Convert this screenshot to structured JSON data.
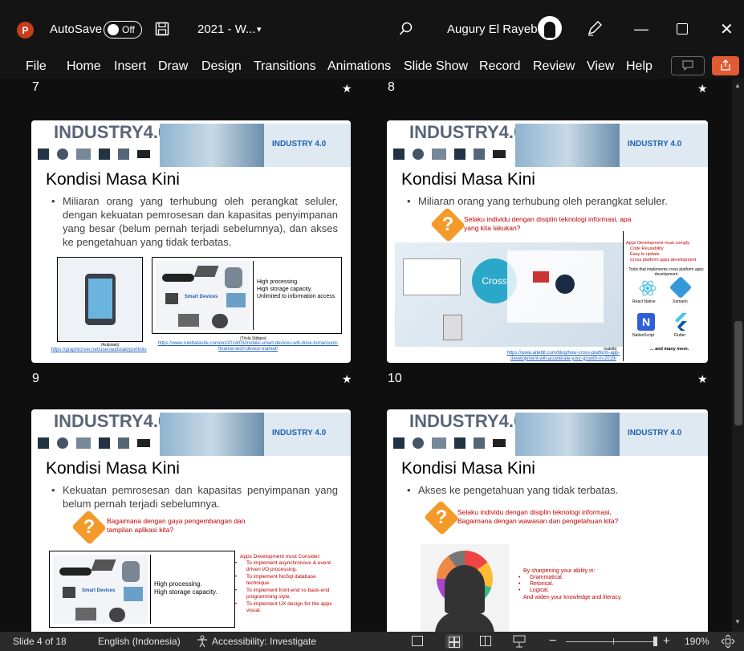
{
  "titlebar": {
    "app_badge": "P",
    "autosave_label": "AutoSave",
    "autosave_state": "Off",
    "doc_title": "2021 - W...",
    "user_name": "Augury El Rayeb"
  },
  "menu": [
    "File",
    "Home",
    "Insert",
    "Draw",
    "Design",
    "Transitions",
    "Animations",
    "Slide Show",
    "Record",
    "Review",
    "View",
    "Help"
  ],
  "slides": [
    {
      "number": "7",
      "banner_title": "INDUSTRY4.0",
      "banner_sub": "INDUSTRY 4.0",
      "heading": "Kondisi Masa Kini",
      "bullet": "Miliaran orang yang terhubung oleh perangkat seluler, dengan kekuatan pemrosesan dan kapasitas penyimpanan yang besar (belum pernah terjadi sebelumnya), dan akses ke pengetahuan yang tidak terbatas.",
      "box_text": "High processing.\nHigh storage capacity.\nUnlimited to information access",
      "smart_devices": "Smart Devices",
      "credit1": "(Autistaki)",
      "link1": "https://graphicriver.net/user/autistaki/portfolio",
      "credit2": "(Trisla Sittiges)",
      "link2": "https://www.rulebatasite.com/en/2014/03/mobile-smart-devices-will-drive-turnaround-finance-tech-device-market/"
    },
    {
      "number": "8",
      "banner_title": "INDUSTRY4.0",
      "banner_sub": "INDUSTRY 4.0",
      "heading": "Kondisi Masa Kini",
      "bullet": "Miliaran orang yang terhubung oleh perangkat seluler.",
      "question": "Selaku individu dengan disiplin teknologi informasi, apa yang kita lakukan?",
      "apps_title": "Apps Development must comply:",
      "apps_items": [
        "Code Reusability",
        "Easy to update",
        "Cross platform apps development"
      ],
      "tools_text": "Tools that implements cross platform apps development",
      "tool_names": [
        "React Native",
        "Xamarin",
        "NativeScript",
        "Flutter"
      ],
      "many_more": "... and many more.",
      "cross_label": "Cross",
      "credit": "(saktib)",
      "link": "https://www.aiteblt.com/blog/how-cross-platform-app-development-will-accelerate-your-growth-in-2019/"
    },
    {
      "number": "9",
      "banner_title": "INDUSTRY4.0",
      "banner_sub": "INDUSTRY 4.0",
      "heading": "Kondisi Masa Kini",
      "bullet": "Kekuatan pemrosesan dan kapasitas penyimpanan yang belum pernah terjadi sebelumnya.",
      "question": "Bagaimana dengan gaya pengembangan dan tampilan aplikasi kita?",
      "box_text": "High processing.\nHigh storage capacity.",
      "smart_devices": "Smart Devices",
      "apps_title": "Apps Development must Consider:",
      "apps_items": [
        "To implement asynchronous & event-driven I/O processing.",
        "To implement NoSql database technique.",
        "To implement front-end vs back-end programming style.",
        "To implement UX design for the apps visual."
      ]
    },
    {
      "number": "10",
      "banner_title": "INDUSTRY4.0",
      "banner_sub": "INDUSTRY 4.0",
      "heading": "Kondisi Masa Kini",
      "bullet": "Akses ke pengetahuan yang tidak terbatas.",
      "question": "Selaku individu dengan disiplin teknologi informasi, Bagaimana dengan wawasan dan pengetahuan kita?",
      "sharpen_title": "By sharpening your ability in:",
      "sharpen_items": [
        "Grammatical.",
        "Retorical.",
        "Logical."
      ],
      "sharpen_footer": "And widen your knowledge and literacy."
    }
  ],
  "statusbar": {
    "slide_info": "Slide 4 of 18",
    "language": "English (Indonesia)",
    "accessibility": "Accessibility: Investigate",
    "zoom": "190%"
  },
  "colors": {
    "accent": "#c43e1c",
    "notification": "#e05a33",
    "question": "#f39a2a",
    "red_text": "#c00000"
  }
}
